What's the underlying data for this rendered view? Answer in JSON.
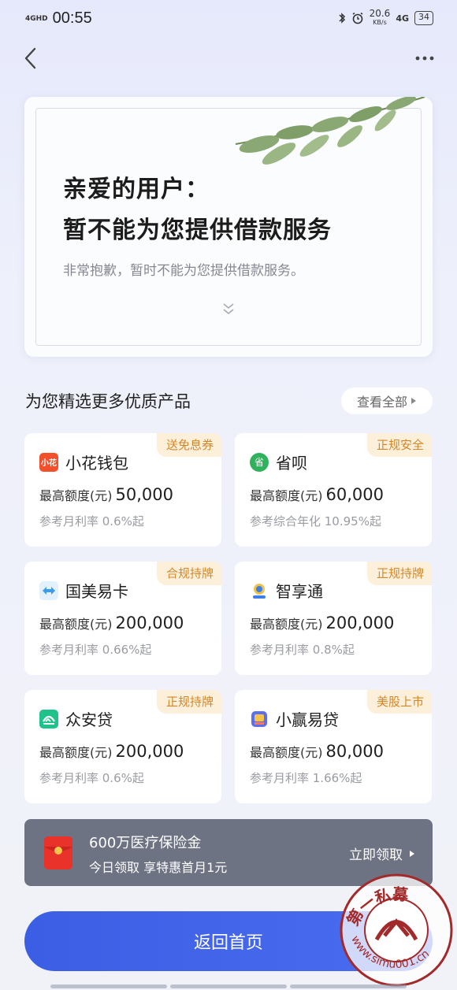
{
  "status_bar": {
    "network": "4GHD",
    "time": "00:55",
    "speed_value": "20.6",
    "speed_unit": "KB/s",
    "cell": "4G",
    "battery": "34"
  },
  "notice": {
    "title_line1": "亲爱的用户：",
    "title_line2": "暂不能为您提供借款服务",
    "subtitle": "非常抱歉，暂时不能为您提供借款服务。"
  },
  "section": {
    "title": "为您精选更多优质产品",
    "see_all": "查看全部"
  },
  "products": [
    {
      "name": "小花钱包",
      "badge": "送免息券",
      "amount_label": "最高额度(元)",
      "amount": "50,000",
      "rate": "参考月利率 0.6%起",
      "logo_text": "小花",
      "icon": "xiaohua-logo-icon",
      "color": "#f2502c"
    },
    {
      "name": "省呗",
      "badge": "正规安全",
      "amount_label": "最高额度(元)",
      "amount": "60,000",
      "rate": "参考综合年化 10.95%起",
      "logo_text": "省",
      "icon": "shengbei-logo-icon",
      "color": "#2fb25b"
    },
    {
      "name": "国美易卡",
      "badge": "合规持牌",
      "amount_label": "最高额度(元)",
      "amount": "200,000",
      "rate": "参考月利率 0.66%起",
      "logo_text": "",
      "icon": "guomei-logo-icon",
      "color": "#3d9be8"
    },
    {
      "name": "智享通",
      "badge": "正规持牌",
      "amount_label": "最高额度(元)",
      "amount": "200,000",
      "rate": "参考月利率 0.8%起",
      "logo_text": "",
      "icon": "zhixiangtong-logo-icon",
      "color": "#3d7ee8"
    },
    {
      "name": "众安贷",
      "badge": "正规持牌",
      "amount_label": "最高额度(元)",
      "amount": "200,000",
      "rate": "参考月利率 0.6%起",
      "logo_text": "",
      "icon": "zhongan-logo-icon",
      "color": "#1fc28b"
    },
    {
      "name": "小赢易贷",
      "badge": "美股上市",
      "amount_label": "最高额度(元)",
      "amount": "80,000",
      "rate": "参考月利率 1.66%起",
      "logo_text": "",
      "icon": "xiaoying-logo-icon",
      "color": "#5b6ff0"
    }
  ],
  "banner": {
    "title": "600万医疗保险金",
    "subtitle": "今日领取 享特惠首月1元",
    "cta": "立即领取"
  },
  "home_button": "返回首页",
  "watermark": {
    "text": "第一私募",
    "url": "www.simu001.cn"
  },
  "colors": {
    "primary": "#3b5ee4",
    "badge_bg": "#fdf0da",
    "badge_text": "#d4872a",
    "banner_bg": "#6e7384"
  }
}
